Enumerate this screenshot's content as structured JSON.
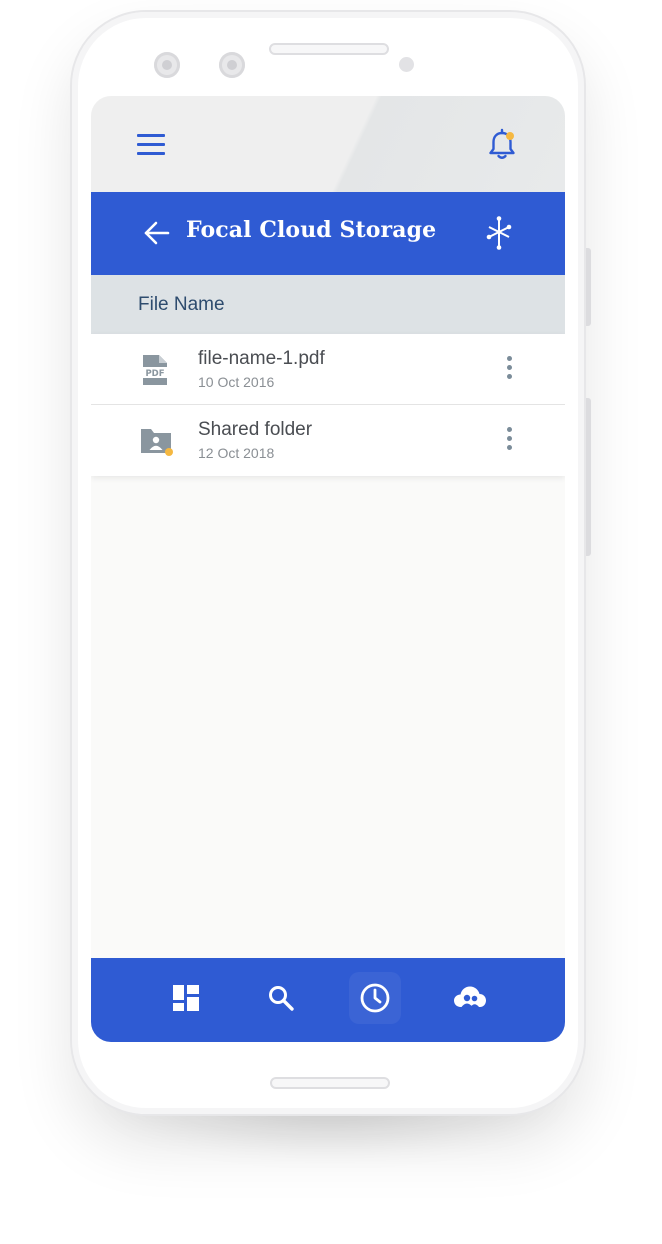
{
  "app": {
    "title": "Focal Cloud Storage"
  },
  "toolbar": {
    "menu_icon": "hamburger-menu-icon",
    "notification_icon": "bell-icon",
    "notification_badge_color": "#f5b841"
  },
  "app_bar": {
    "back_icon": "arrow-left-icon",
    "share_icon": "share-network-icon"
  },
  "list_header": {
    "column_label": "File Name"
  },
  "files": [
    {
      "name": "file-name-1.pdf",
      "date": "10 Oct 2016",
      "icon": "pdf-file-icon"
    },
    {
      "name": "Shared folder",
      "date": "12 Oct 2018",
      "icon": "shared-folder-icon"
    }
  ],
  "bottom_nav": [
    {
      "icon": "dashboard-icon",
      "active": false
    },
    {
      "icon": "search-icon",
      "active": false
    },
    {
      "icon": "clock-icon",
      "active": true
    },
    {
      "icon": "cloud-users-icon",
      "active": false
    }
  ],
  "colors": {
    "primary": "#2f5bd3",
    "header_bg": "#dde2e5",
    "accent": "#f5b841",
    "icon_gray": "#8a969f"
  }
}
